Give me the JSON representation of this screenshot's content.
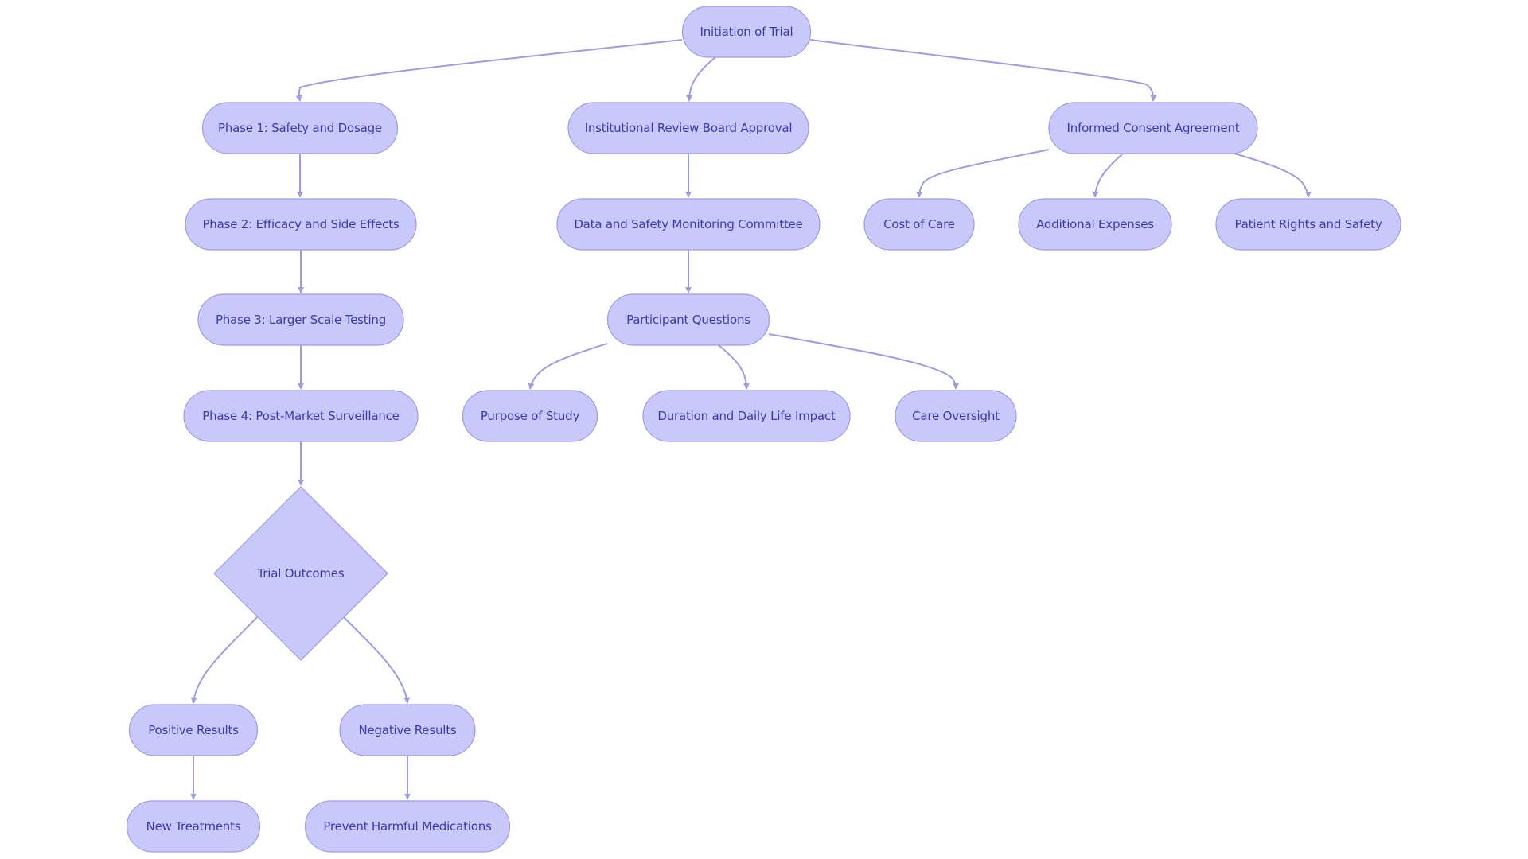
{
  "diagram": {
    "type": "flowchart",
    "direction": "top-down",
    "colors": {
      "node_fill": "#c8c8fa",
      "node_stroke": "#9c9ce8",
      "edge": "#9c9ce8",
      "text": "#3b3ba8",
      "background": "#ffffff"
    },
    "nodes": [
      {
        "id": "initiation",
        "label": "Initiation of Trial",
        "shape": "stadium"
      },
      {
        "id": "phase1",
        "label": "Phase 1: Safety and Dosage",
        "shape": "stadium"
      },
      {
        "id": "irb",
        "label": "Institutional Review Board Approval",
        "shape": "stadium"
      },
      {
        "id": "consent",
        "label": "Informed Consent Agreement",
        "shape": "stadium"
      },
      {
        "id": "phase2",
        "label": "Phase 2: Efficacy and Side Effects",
        "shape": "stadium"
      },
      {
        "id": "dsmc",
        "label": "Data and Safety Monitoring Committee",
        "shape": "stadium"
      },
      {
        "id": "cost",
        "label": "Cost of Care",
        "shape": "stadium"
      },
      {
        "id": "expenses",
        "label": "Additional Expenses",
        "shape": "stadium"
      },
      {
        "id": "rights",
        "label": "Patient Rights and Safety",
        "shape": "stadium"
      },
      {
        "id": "phase3",
        "label": "Phase 3: Larger Scale Testing",
        "shape": "stadium"
      },
      {
        "id": "questions",
        "label": "Participant Questions",
        "shape": "stadium"
      },
      {
        "id": "phase4",
        "label": "Phase 4: Post-Market Surveillance",
        "shape": "stadium"
      },
      {
        "id": "purpose",
        "label": "Purpose of Study",
        "shape": "stadium"
      },
      {
        "id": "duration",
        "label": "Duration and Daily Life Impact",
        "shape": "stadium"
      },
      {
        "id": "oversight",
        "label": "Care Oversight",
        "shape": "stadium"
      },
      {
        "id": "outcomes",
        "label": "Trial Outcomes",
        "shape": "diamond"
      },
      {
        "id": "positive",
        "label": "Positive Results",
        "shape": "stadium"
      },
      {
        "id": "negative",
        "label": "Negative Results",
        "shape": "stadium"
      },
      {
        "id": "treatments",
        "label": "New Treatments",
        "shape": "stadium"
      },
      {
        "id": "prevent",
        "label": "Prevent Harmful Medications",
        "shape": "stadium"
      }
    ],
    "edges": [
      {
        "from": "initiation",
        "to": "phase1"
      },
      {
        "from": "initiation",
        "to": "irb"
      },
      {
        "from": "initiation",
        "to": "consent"
      },
      {
        "from": "phase1",
        "to": "phase2"
      },
      {
        "from": "phase2",
        "to": "phase3"
      },
      {
        "from": "phase3",
        "to": "phase4"
      },
      {
        "from": "phase4",
        "to": "outcomes"
      },
      {
        "from": "outcomes",
        "to": "positive"
      },
      {
        "from": "outcomes",
        "to": "negative"
      },
      {
        "from": "positive",
        "to": "treatments"
      },
      {
        "from": "negative",
        "to": "prevent"
      },
      {
        "from": "irb",
        "to": "dsmc"
      },
      {
        "from": "dsmc",
        "to": "questions"
      },
      {
        "from": "questions",
        "to": "purpose"
      },
      {
        "from": "questions",
        "to": "duration"
      },
      {
        "from": "questions",
        "to": "oversight"
      },
      {
        "from": "consent",
        "to": "cost"
      },
      {
        "from": "consent",
        "to": "expenses"
      },
      {
        "from": "consent",
        "to": "rights"
      }
    ]
  }
}
